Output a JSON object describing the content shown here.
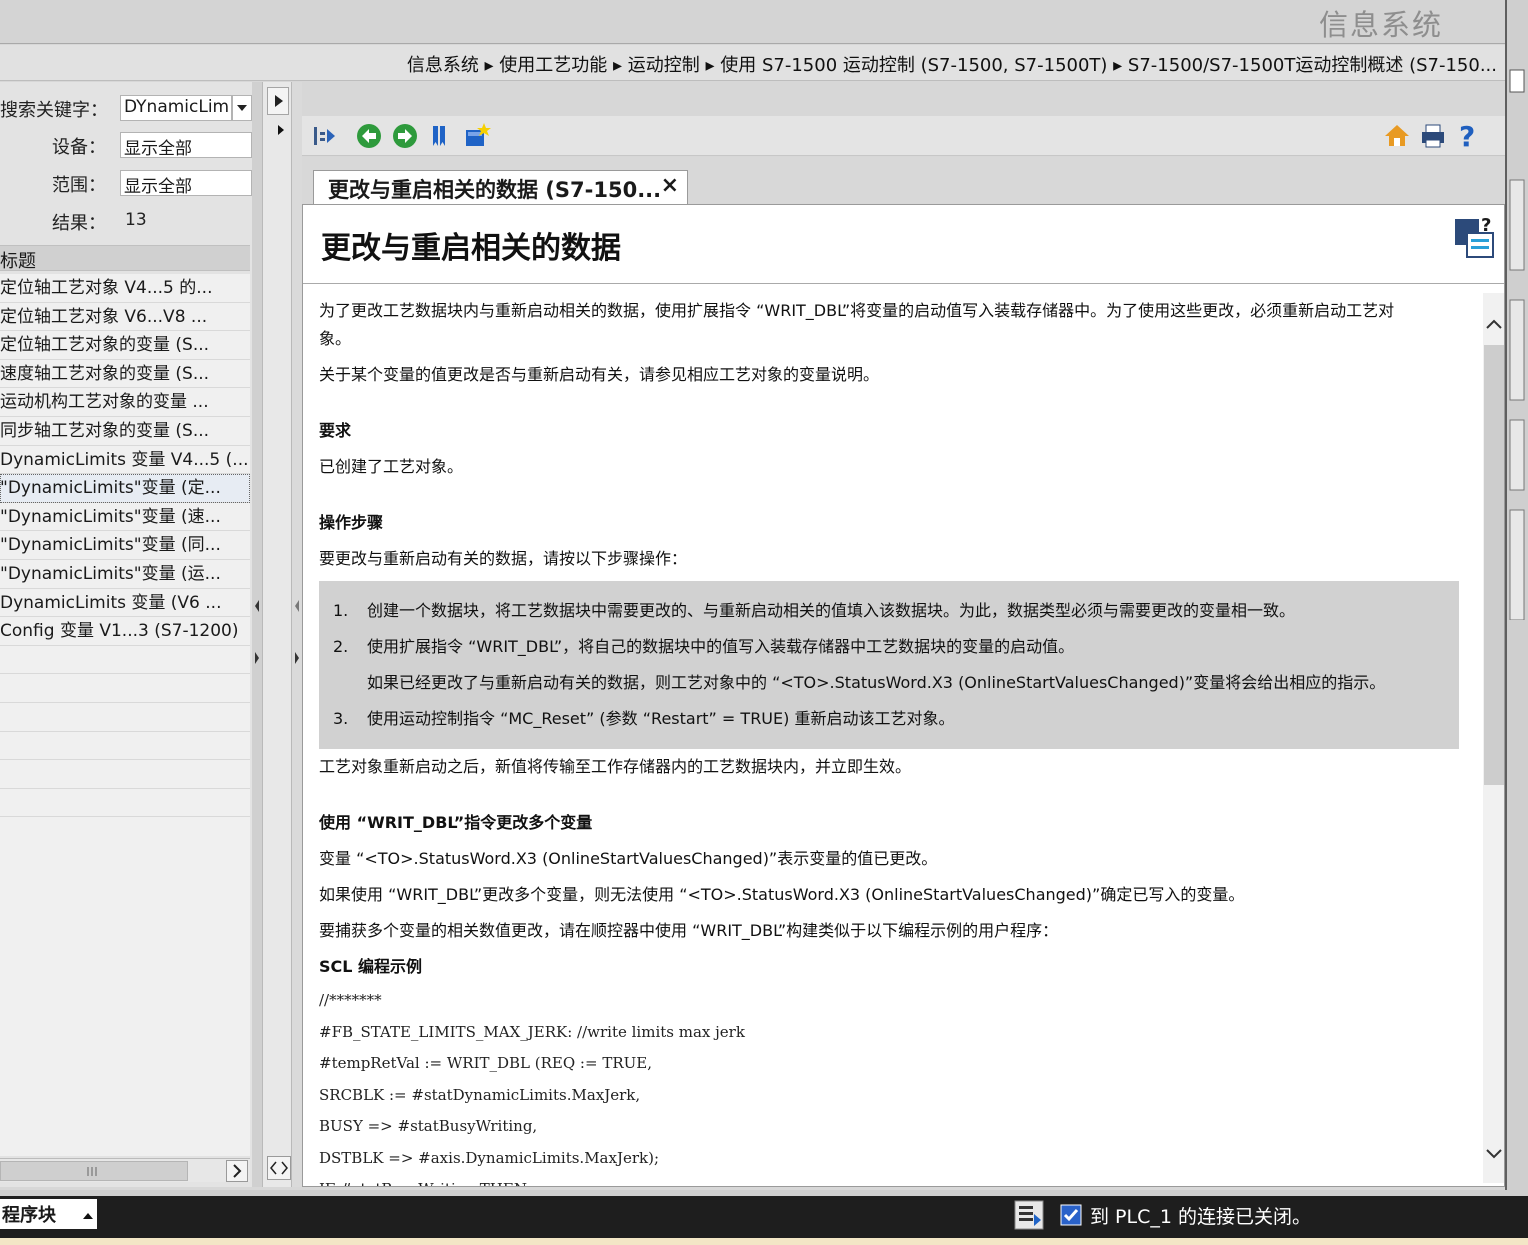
{
  "header": {
    "app_title": "信息系统",
    "breadcrumb": "信息系统 ▸ 使用工艺功能 ▸ 运动控制 ▸ 使用 S7-1500 运动控制 (S7-1500, S7-1500T) ▸ S7-1500/S7-1500T运动控制概述 (S7-150..."
  },
  "search": {
    "keyword_label": "搜索关键字：",
    "keyword_value": "DYnamicLim",
    "device_label": "设备：",
    "device_value": "显示全部",
    "scope_label": "范围：",
    "scope_value": "显示全部",
    "result_label": "结果：",
    "result_count": "13",
    "column_header": "标题",
    "results": [
      "定位轴工艺对象 V4...5 的...",
      "定位轴工艺对象 V6...V8 ...",
      "定位轴工艺对象的变量 (S...",
      "速度轴工艺对象的变量 (S...",
      "运动机构工艺对象的变量 ...",
      "同步轴工艺对象的变量 (S...",
      "DynamicLimits 变量 V4...5 (...",
      "\"DynamicLimits\"变量 (定...",
      "\"DynamicLimits\"变量 (速...",
      "\"DynamicLimits\"变量 (同...",
      "\"DynamicLimits\"变量 (运...",
      "DynamicLimits 变量 (V6 ...",
      "Config 变量 V1...3 (S7-1200)"
    ],
    "selected_index": 7
  },
  "tab": {
    "title": "更改与重启相关的数据 (S7-150...",
    "close": "×"
  },
  "doc": {
    "title": "更改与重启相关的数据",
    "intro1": "为了更改工艺数据块内与重新启动相关的数据，使用扩展指令 “WRIT_DBL”将变量的启动值写入装载存储器中。为了使用这些更改，必须重新启动工艺对",
    "intro1b": "象。",
    "intro2": "关于某个变量的值更改是否与重新启动有关，请参见相应工艺对象的变量说明。",
    "req_heading": "要求",
    "req_text": "已创建了工艺对象。",
    "steps_heading": "操作步骤",
    "steps_intro": "要更改与重新启动有关的数据，请按以下步骤操作：",
    "step1_num": "1.",
    "step1": "创建一个数据块，将工艺数据块中需要更改的、与重新启动相关的值填入该数据块。为此，数据类型必须与需要更改的变量相一致。",
    "step2_num": "2.",
    "step2": "使用扩展指令 “WRIT_DBL”，将自己的数据块中的值写入装载存储器中工艺数据块的变量的启动值。",
    "step2_note": "如果已经更改了与重新启动有关的数据，则工艺对象中的 “<TO>.StatusWord.X3 (OnlineStartValuesChanged)”变量将会给出相应的指示。",
    "step3_num": "3.",
    "step3": "使用运动控制指令 “MC_Reset” (参数 “Restart” = TRUE) 重新启动该工艺对象。",
    "after_steps": "工艺对象重新启动之后，新值将传输至工作存储器内的工艺数据块内，并立即生效。",
    "multi_heading": "使用 “WRIT_DBL”指令更改多个变量",
    "multi1": "变量 “<TO>.StatusWord.X3 (OnlineStartValuesChanged)”表示变量的值已更改。",
    "multi2": "如果使用 “WRIT_DBL”更改多个变量，则无法使用 “<TO>.StatusWord.X3 (OnlineStartValuesChanged)”确定已写入的变量。",
    "multi3": "要捕获多个变量的相关数值更改，请在顺控器中使用 “WRIT_DBL”构建类似于以下编程示例的用户程序：",
    "scl_heading": "SCL 编程示例",
    "code": [
      "//*******",
      "#FB_STATE_LIMITS_MAX_JERK: //write limits max jerk",
      "#tempRetVal := WRIT_DBL (REQ := TRUE,",
      "SRCBLK := #statDynamicLimits.MaxJerk,",
      "BUSY => #statBusyWriting,",
      "DSTBLK => #axis.DynamicLimits.MaxJerk);",
      "IF #statBusyWriting THEN"
    ]
  },
  "status": {
    "editor_tab": "程序块",
    "connection_message": "到 PLC_1 的连接已关闭。"
  },
  "colors": {
    "accent_green": "#2e9a3c",
    "accent_blue": "#1f63c6",
    "status_bg": "#1e1e1e"
  }
}
